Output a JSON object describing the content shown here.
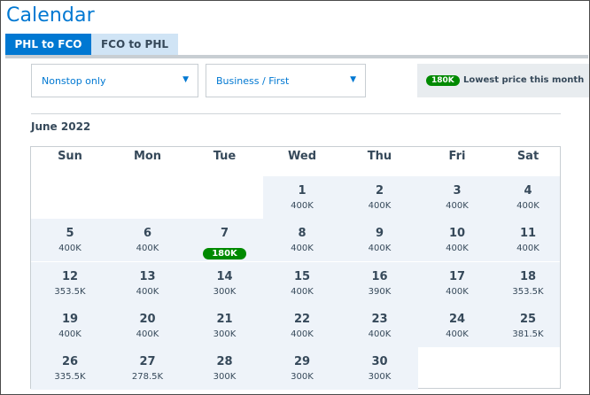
{
  "title": "Calendar",
  "tabs": [
    {
      "label": "PHL to FCO",
      "active": true
    },
    {
      "label": "FCO to PHL",
      "active": false
    }
  ],
  "filters": {
    "stops": {
      "value": "Nonstop only",
      "icon": "caret-down-icon"
    },
    "cabin": {
      "value": "Business / First",
      "icon": "caret-down-icon"
    }
  },
  "legend": {
    "badge": "180K",
    "text": "Lowest price this month"
  },
  "calendar": {
    "month": "June 2022",
    "weekdays": [
      "Sun",
      "Mon",
      "Tue",
      "Wed",
      "Thu",
      "Fri",
      "Sat"
    ],
    "first_weekday_index": 3,
    "lowest_color": "#008a00",
    "days": [
      {
        "day": "1",
        "price": "400K"
      },
      {
        "day": "2",
        "price": "400K"
      },
      {
        "day": "3",
        "price": "400K"
      },
      {
        "day": "4",
        "price": "400K"
      },
      {
        "day": "5",
        "price": "400K"
      },
      {
        "day": "6",
        "price": "400K"
      },
      {
        "day": "7",
        "price": "180K",
        "lowest": true
      },
      {
        "day": "8",
        "price": "400K"
      },
      {
        "day": "9",
        "price": "400K"
      },
      {
        "day": "10",
        "price": "400K"
      },
      {
        "day": "11",
        "price": "400K"
      },
      {
        "day": "12",
        "price": "353.5K"
      },
      {
        "day": "13",
        "price": "400K"
      },
      {
        "day": "14",
        "price": "300K"
      },
      {
        "day": "15",
        "price": "400K"
      },
      {
        "day": "16",
        "price": "390K"
      },
      {
        "day": "17",
        "price": "400K"
      },
      {
        "day": "18",
        "price": "353.5K"
      },
      {
        "day": "19",
        "price": "400K"
      },
      {
        "day": "20",
        "price": "400K"
      },
      {
        "day": "21",
        "price": "300K"
      },
      {
        "day": "22",
        "price": "400K"
      },
      {
        "day": "23",
        "price": "400K"
      },
      {
        "day": "24",
        "price": "400K"
      },
      {
        "day": "25",
        "price": "381.5K"
      },
      {
        "day": "26",
        "price": "335.5K"
      },
      {
        "day": "27",
        "price": "278.5K"
      },
      {
        "day": "28",
        "price": "300K"
      },
      {
        "day": "29",
        "price": "300K"
      },
      {
        "day": "30",
        "price": "300K"
      }
    ]
  }
}
